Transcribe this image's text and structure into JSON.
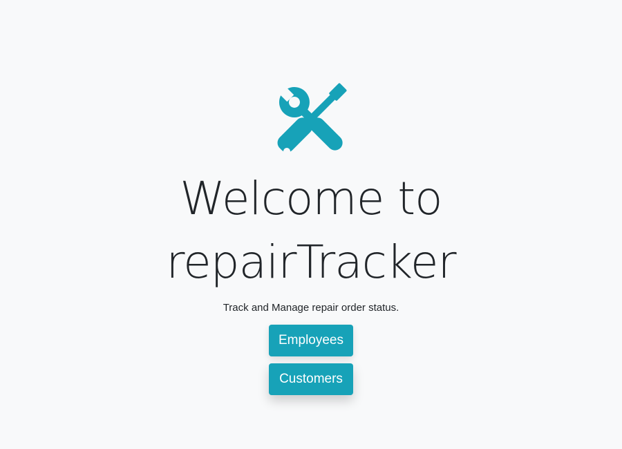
{
  "logo": {
    "icon": "wrench-screwdriver-icon",
    "color": "#17a2b8"
  },
  "hero": {
    "title_line1": "Welcome to",
    "title_line2": "repairTracker",
    "subtitle": "Track and Manage repair order status."
  },
  "buttons": {
    "employees_label": "Employees",
    "customers_label": "Customers"
  },
  "colors": {
    "background": "#f8f9fa",
    "accent": "#17a2b8",
    "text": "#212529"
  }
}
